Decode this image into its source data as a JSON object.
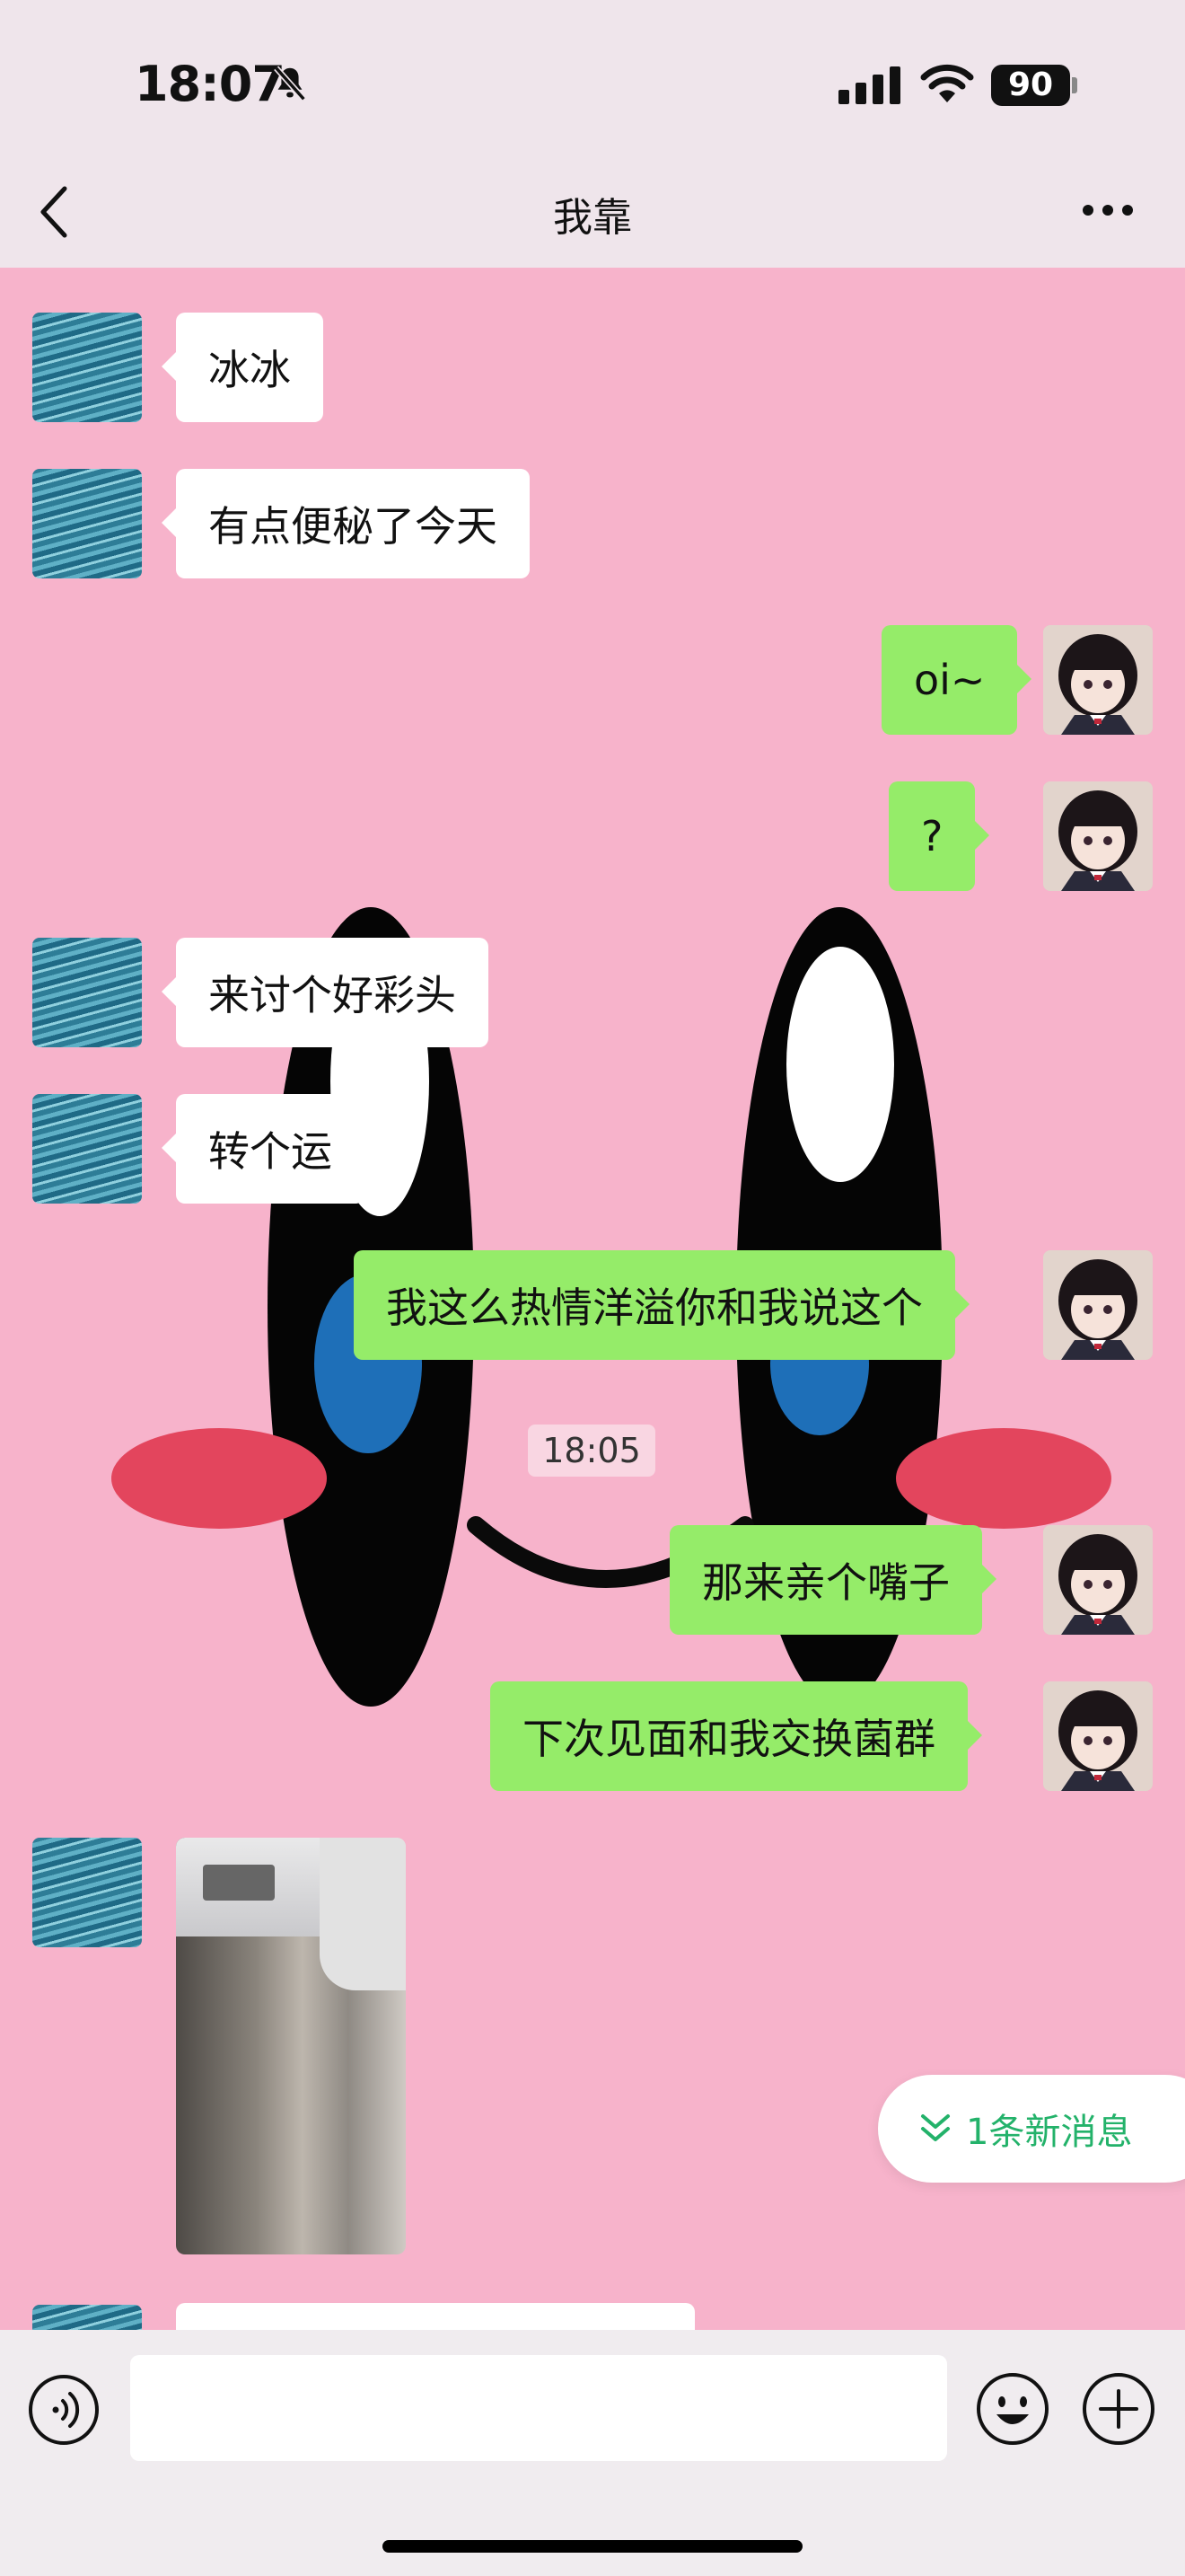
{
  "status_bar": {
    "time": "18:07",
    "battery": "90",
    "icons": [
      "bell-slash-icon",
      "signal-icon",
      "wifi-icon",
      "battery-icon"
    ]
  },
  "nav": {
    "title": "我靠",
    "back_icon": "chevron-left-icon",
    "more_icon": "more-icon"
  },
  "messages": [
    {
      "side": "left",
      "type": "text",
      "text": "冰冰"
    },
    {
      "side": "left",
      "type": "text",
      "text": "有点便秘了今天"
    },
    {
      "side": "right",
      "type": "text",
      "text": "oi~"
    },
    {
      "side": "right",
      "type": "text",
      "text": "?"
    },
    {
      "side": "left",
      "type": "text",
      "text": "来讨个好彩头"
    },
    {
      "side": "left",
      "type": "text",
      "text": "转个运"
    },
    {
      "side": "right",
      "type": "text",
      "text": "我这么热情洋溢你和我说这个"
    },
    {
      "side": "right",
      "type": "text",
      "text": "那来亲个嘴子"
    },
    {
      "side": "right",
      "type": "text",
      "text": "下次见面和我交换菌群"
    },
    {
      "side": "left",
      "type": "image",
      "text": ""
    }
  ],
  "timestamp": "18:05",
  "new_message_pill": {
    "label": "1条新消息",
    "icon": "double-chevron-down-icon"
  },
  "input_bar": {
    "voice_icon": "voice-icon",
    "emoji_icon": "emoji-icon",
    "add_icon": "plus-circle-icon",
    "value": ""
  },
  "colors": {
    "chat_bg": "#f7b3cb",
    "my_bubble": "#95ec69",
    "their_bubble": "#ffffff",
    "accent_green": "#23b26a"
  }
}
